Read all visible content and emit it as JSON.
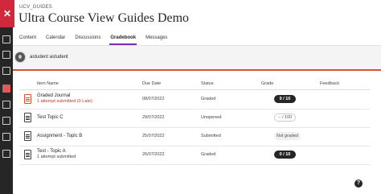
{
  "nav": {
    "close_label": "✕",
    "rail_icons": [
      "institution-icon",
      "calendar-icon",
      "messages-icon",
      "grades-icon",
      "tools-icon",
      "mail-icon",
      "profile-icon",
      "signout-icon"
    ]
  },
  "course": {
    "code": "UCV_GUIDES",
    "title": "Ultra Course View Guides Demo"
  },
  "tabs": [
    {
      "label": "Content",
      "active": false
    },
    {
      "label": "Calendar",
      "active": false
    },
    {
      "label": "Discussions",
      "active": false
    },
    {
      "label": "Gradebook",
      "active": true
    },
    {
      "label": "Messages",
      "active": false
    }
  ],
  "student": {
    "name": "astudent astudent"
  },
  "gradebook": {
    "columns": [
      "Item Name",
      "Due Date",
      "Status",
      "Grade",
      "Feedback"
    ],
    "rows": [
      {
        "name": "Graded Journal",
        "sub": "1 attempt submitted (0 Late)",
        "due": "08/07/2022",
        "status": "Graded",
        "grade": "9 / 10",
        "icon": "journal-icon"
      },
      {
        "name": "Test Topic C",
        "sub": "",
        "due": "29/07/2022",
        "status": "Unopened",
        "grade": "-- / 100",
        "icon": "test-icon"
      },
      {
        "name": "Assignment - Topic B",
        "sub": "",
        "due": "25/07/2022",
        "status": "Submitted",
        "grade": "Not graded",
        "icon": "assignment-icon"
      },
      {
        "name": "Test - Topic A",
        "sub": "1 attempt submitted",
        "due": "26/07/2022",
        "status": "Graded",
        "grade": "0 / 10",
        "icon": "test-icon"
      }
    ]
  },
  "help": {
    "label": "?"
  },
  "colors": {
    "accent_red": "#d0293d",
    "late_red": "#c0392b",
    "tab_underline": "#7a2fb0",
    "band_border": "#d6532f",
    "rail_bg": "#262626"
  }
}
